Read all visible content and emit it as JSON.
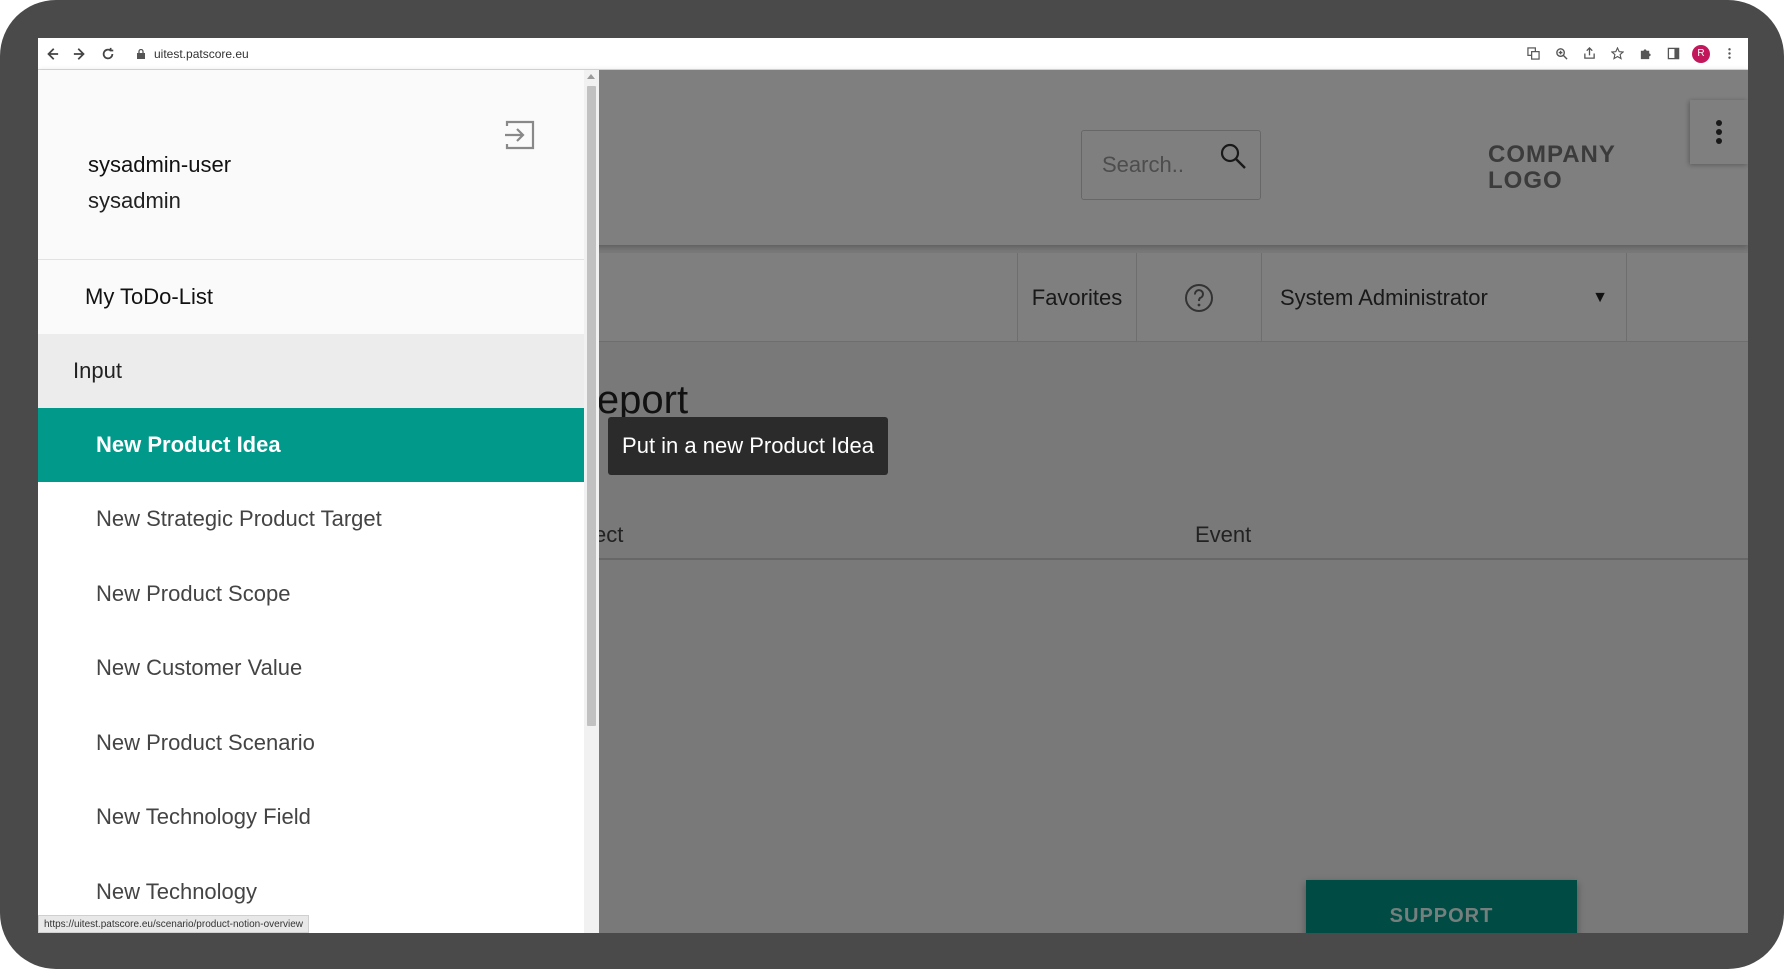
{
  "browser": {
    "url": "uitest.patscore.eu",
    "avatar_letter": "R",
    "status_url": "https://uitest.patscore.eu/scenario/product-notion-overview"
  },
  "header": {
    "search_placeholder": "Search..",
    "company_logo_line1": "COMPANY",
    "company_logo_line2": "LOGO"
  },
  "subbar": {
    "favorites_label": "Favorites",
    "role_value": "System Administrator"
  },
  "main": {
    "report_title_visible": "ws Report",
    "columns": [
      "ect",
      "Event"
    ]
  },
  "support_label": "SUPPORT",
  "drawer": {
    "user_name": "sysadmin-user",
    "user_role": "sysadmin",
    "todo_label": "My ToDo-List",
    "section_label": "Input",
    "items": [
      {
        "label": "New Product Idea",
        "active": true
      },
      {
        "label": "New Strategic Product Target",
        "active": false
      },
      {
        "label": "New Product Scope",
        "active": false
      },
      {
        "label": "New Customer Value",
        "active": false
      },
      {
        "label": "New Product Scenario",
        "active": false
      },
      {
        "label": "New Technology Field",
        "active": false
      },
      {
        "label": "New Technology",
        "active": false
      }
    ]
  },
  "tooltip": "Put in a new Product Idea",
  "colors": {
    "accent": "#00998a",
    "frame": "#4a4a4a",
    "tooltip_bg": "#2b2b2b"
  }
}
